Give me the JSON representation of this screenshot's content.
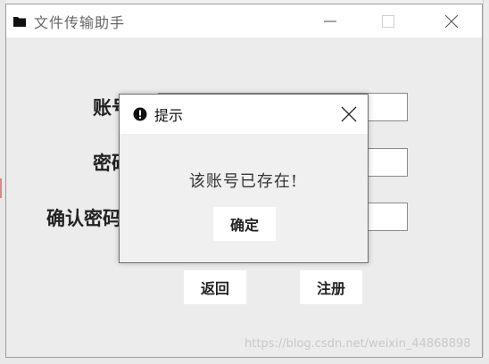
{
  "window": {
    "title": "文件传输助手"
  },
  "form": {
    "account_label": "账号",
    "password_label": "密码",
    "confirm_label": "确认密码"
  },
  "actions": {
    "back_label": "返回",
    "register_label": "注册"
  },
  "dialog": {
    "title": "提示",
    "message": "该账号已存在!",
    "ok_label": "确定"
  },
  "watermark": "https://blog.csdn.net/weixin_44868898",
  "icons": {
    "window_icon": "folder-icon",
    "dialog_icon": "warning-icon"
  },
  "colors": {
    "titlebar": "#ffffff",
    "window_bg": "#ececec",
    "dialog_border": "#6e6e6e"
  }
}
